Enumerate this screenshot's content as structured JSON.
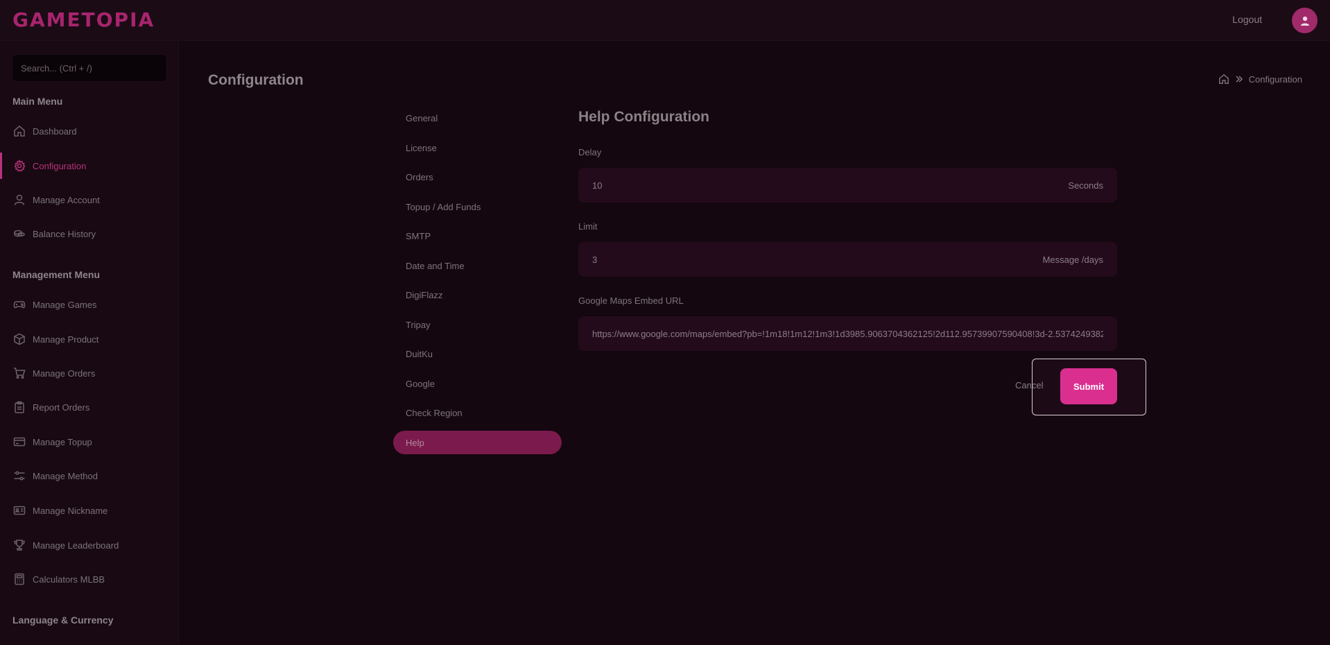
{
  "header": {
    "logo": "GAMETOPIA",
    "logout_label": "Logout",
    "avatar_icon": "user-icon"
  },
  "sidebar": {
    "search_placeholder": "Search... (Ctrl + /)",
    "main_menu_heading": "Main Menu",
    "main_items": [
      {
        "label": "Dashboard",
        "icon": "home-icon"
      },
      {
        "label": "Configuration",
        "icon": "gear-icon",
        "active": true
      },
      {
        "label": "Manage Account",
        "icon": "user-icon"
      },
      {
        "label": "Balance History",
        "icon": "coins-icon"
      }
    ],
    "management_heading": "Management Menu",
    "management_items": [
      {
        "label": "Manage Games",
        "icon": "gamepad-icon"
      },
      {
        "label": "Manage Product",
        "icon": "box-icon"
      },
      {
        "label": "Manage Orders",
        "icon": "cart-icon"
      },
      {
        "label": "Report Orders",
        "icon": "clipboard-icon"
      },
      {
        "label": "Manage Topup",
        "icon": "card-icon"
      },
      {
        "label": "Manage Method",
        "icon": "sliders-icon"
      },
      {
        "label": "Manage Nickname",
        "icon": "id-card-icon"
      },
      {
        "label": "Manage Leaderboard",
        "icon": "trophy-icon"
      },
      {
        "label": "Calculators MLBB",
        "icon": "calculator-icon"
      }
    ],
    "language_heading": "Language & Currency"
  },
  "main": {
    "page_title": "Configuration",
    "breadcrumb": {
      "current": "Configuration"
    },
    "subnav": [
      "General",
      "License",
      "Orders",
      "Topup / Add Funds",
      "SMTP",
      "Date and Time",
      "DigiFlazz",
      "Tripay",
      "DuitKu",
      "Google",
      "Check Region",
      "Help"
    ],
    "subnav_active": "Help",
    "form": {
      "title": "Help Configuration",
      "delay": {
        "label": "Delay",
        "value": "10",
        "unit": "Seconds"
      },
      "limit": {
        "label": "Limit",
        "value": "3",
        "unit": "Message /days"
      },
      "maps": {
        "label": "Google Maps Embed URL",
        "value": "https://www.google.com/maps/embed?pb=!1m18!1m12!1m3!1d3985.9063704362125!2d112.95739907590408!3d-2.5374249382"
      },
      "cancel_label": "Cancel",
      "submit_label": "Submit"
    }
  }
}
